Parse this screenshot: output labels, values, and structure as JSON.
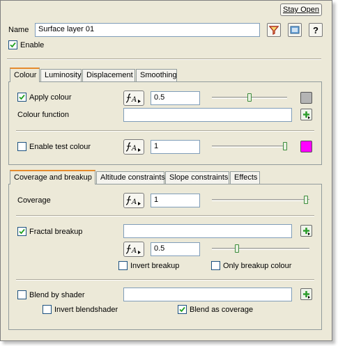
{
  "header": {
    "stay_open_label": "Stay Open"
  },
  "name_row": {
    "label": "Name",
    "value": "Surface layer 01"
  },
  "enable": {
    "label": "Enable",
    "checked": true
  },
  "colour_tabs": [
    "Colour",
    "Luminosity",
    "Displacement",
    "Smoothing"
  ],
  "colour_panel": {
    "apply_colour": {
      "label": "Apply colour",
      "checked": true,
      "value": "0.5",
      "slider_fraction": 0.5,
      "swatch_color": "#b4b4b4"
    },
    "colour_function": {
      "label": "Colour function",
      "value": ""
    },
    "test_colour": {
      "label": "Enable test colour",
      "checked": false,
      "value": "1",
      "slider_fraction": 1.0,
      "swatch_color": "#ff00ff"
    }
  },
  "coverage_tabs": [
    "Coverage and breakup",
    "Altitude constraints",
    "Slope constraints",
    "Effects"
  ],
  "coverage_panel": {
    "coverage": {
      "label": "Coverage",
      "value": "1",
      "slider_fraction": 1.0
    },
    "fractal_breakup": {
      "label": "Fractal breakup",
      "checked": true,
      "shader_value": "",
      "value": "0.5",
      "slider_fraction": 0.13
    },
    "invert_breakup": {
      "label": "Invert breakup",
      "checked": false
    },
    "only_breakup_colour": {
      "label": "Only breakup colour",
      "checked": false
    },
    "blend_by_shader": {
      "label": "Blend by shader",
      "checked": false,
      "shader_value": ""
    },
    "invert_blendshader": {
      "label": "Invert blendshader",
      "checked": false
    },
    "blend_as_coverage": {
      "label": "Blend as coverage",
      "checked": true
    }
  },
  "colors": {
    "accent_tab": "#e68b2c",
    "check_green": "#21a121",
    "plus_green": "#2e9e2e"
  }
}
